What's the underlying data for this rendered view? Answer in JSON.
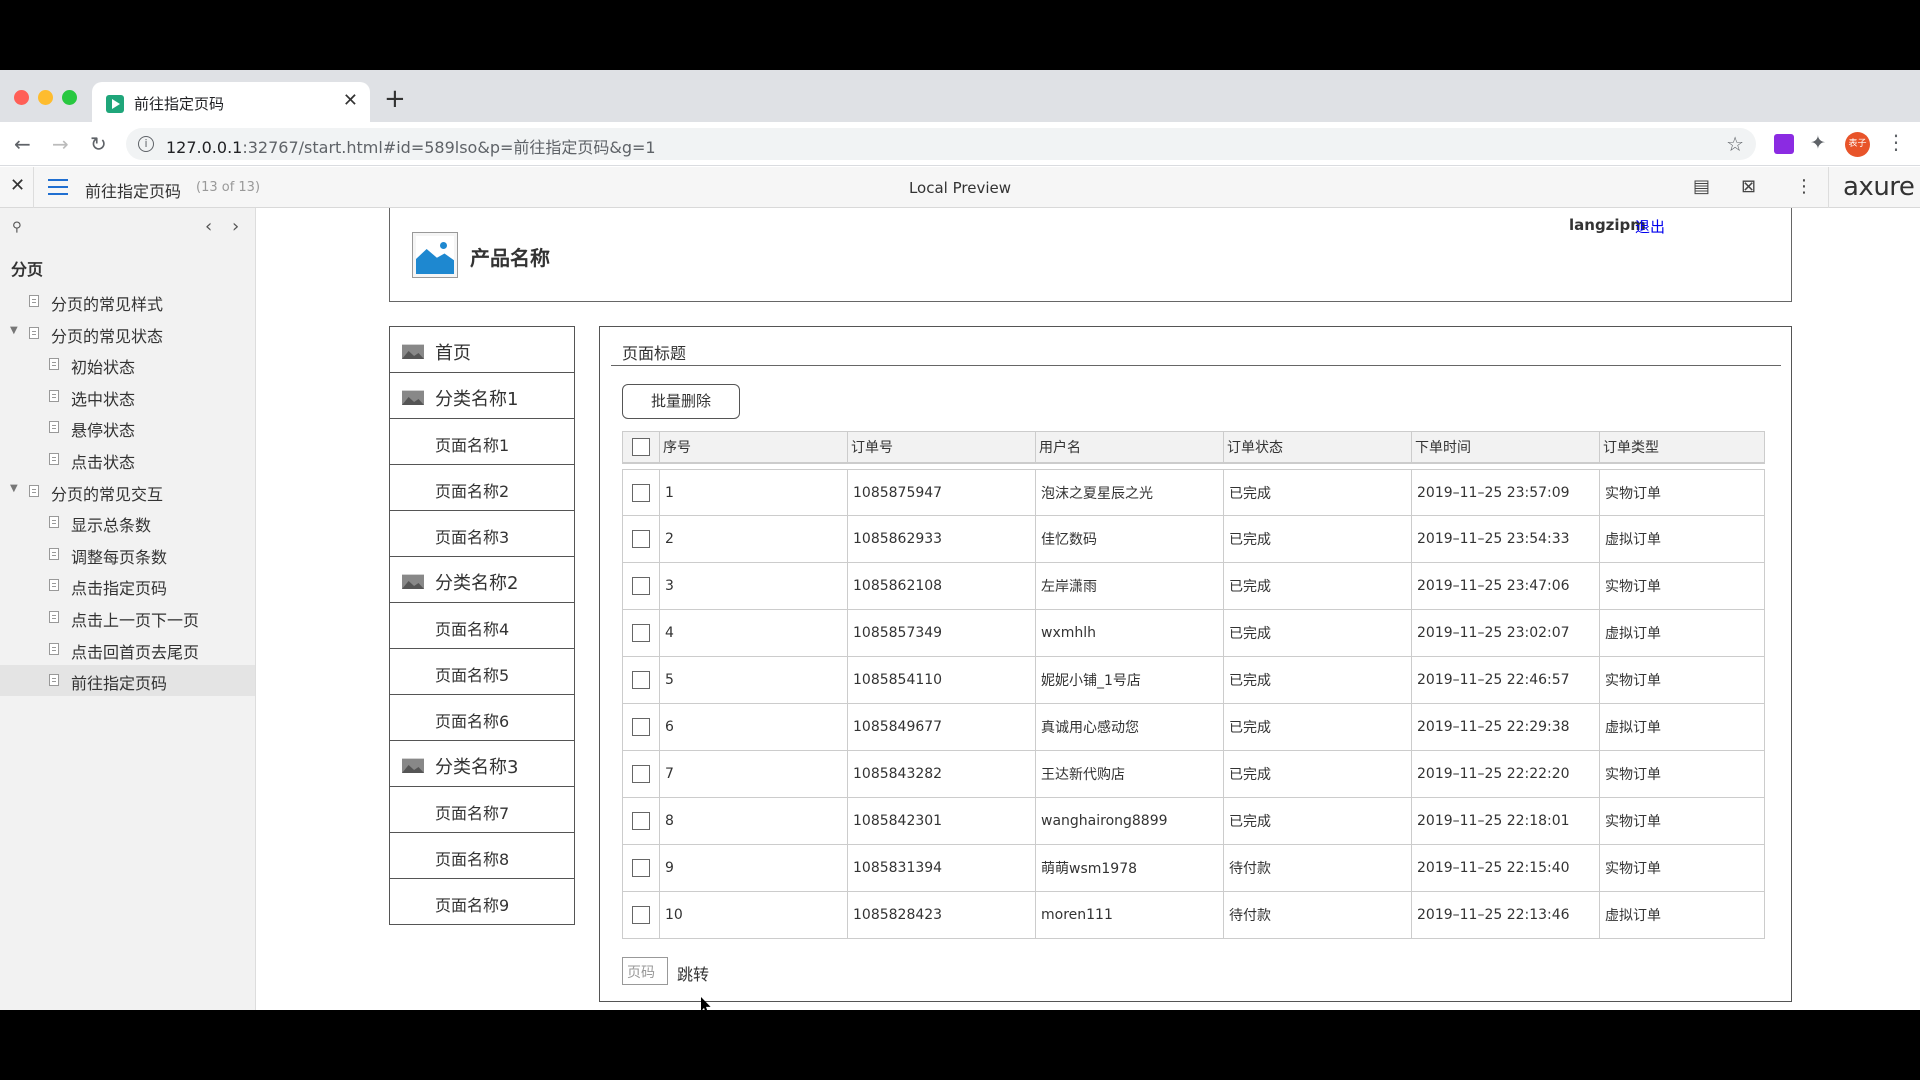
{
  "browser": {
    "tab_title": "前往指定页码",
    "tab_close": "✕",
    "new_tab": "+",
    "url_host": "127.0.0.1",
    "url_rest": ":32767/start.html#id=589lso&p=前往指定页码&g=1",
    "avatar_text": "表子"
  },
  "axure": {
    "close": "✕",
    "page_title": "前往指定页码",
    "page_count": "(13 of 13)",
    "center": "Local Preview",
    "logo": "axure"
  },
  "sitemap": {
    "heading": "分页",
    "items": [
      {
        "label": "分页的常见样式",
        "level": 1,
        "arrow": ""
      },
      {
        "label": "分页的常见状态",
        "level": 1,
        "arrow": "▼"
      },
      {
        "label": "初始状态",
        "level": 2,
        "arrow": ""
      },
      {
        "label": "选中状态",
        "level": 2,
        "arrow": ""
      },
      {
        "label": "悬停状态",
        "level": 2,
        "arrow": ""
      },
      {
        "label": "点击状态",
        "level": 2,
        "arrow": ""
      },
      {
        "label": "分页的常见交互",
        "level": 1,
        "arrow": "▼"
      },
      {
        "label": "显示总条数",
        "level": 2,
        "arrow": ""
      },
      {
        "label": "调整每页条数",
        "level": 2,
        "arrow": ""
      },
      {
        "label": "点击指定页码",
        "level": 2,
        "arrow": ""
      },
      {
        "label": "点击上一页下一页",
        "level": 2,
        "arrow": ""
      },
      {
        "label": "点击回首页去尾页",
        "level": 2,
        "arrow": ""
      },
      {
        "label": "前往指定页码",
        "level": 2,
        "arrow": "",
        "selected": true
      }
    ]
  },
  "header": {
    "product_name": "产品名称",
    "username": "langzipm",
    "logout": "退出"
  },
  "nav": [
    {
      "label": "首页",
      "type": "cat"
    },
    {
      "label": "分类名称1",
      "type": "cat"
    },
    {
      "label": "页面名称1",
      "type": "sub"
    },
    {
      "label": "页面名称2",
      "type": "sub"
    },
    {
      "label": "页面名称3",
      "type": "sub"
    },
    {
      "label": "分类名称2",
      "type": "cat"
    },
    {
      "label": "页面名称4",
      "type": "sub"
    },
    {
      "label": "页面名称5",
      "type": "sub"
    },
    {
      "label": "页面名称6",
      "type": "sub"
    },
    {
      "label": "分类名称3",
      "type": "cat"
    },
    {
      "label": "页面名称7",
      "type": "sub"
    },
    {
      "label": "页面名称8",
      "type": "sub"
    },
    {
      "label": "页面名称9",
      "type": "sub"
    }
  ],
  "content": {
    "page_title": "页面标题",
    "batch_delete": "批量删除",
    "columns": [
      "序号",
      "订单号",
      "用户名",
      "订单状态",
      "下单时间",
      "订单类型"
    ],
    "rows": [
      [
        "1",
        "1085875947",
        "泡沫之夏星辰之光",
        "已完成",
        "2019–11–25 23:57:09",
        "实物订单"
      ],
      [
        "2",
        "1085862933",
        "佳忆数码",
        "已完成",
        "2019–11–25 23:54:33",
        "虚拟订单"
      ],
      [
        "3",
        "1085862108",
        "左岸潇雨",
        "已完成",
        "2019–11–25 23:47:06",
        "实物订单"
      ],
      [
        "4",
        "1085857349",
        "wxmhlh",
        "已完成",
        "2019–11–25 23:02:07",
        "虚拟订单"
      ],
      [
        "5",
        "1085854110",
        "妮妮小铺_1号店",
        "已完成",
        "2019–11–25 22:46:57",
        "实物订单"
      ],
      [
        "6",
        "1085849677",
        "真诚用心感动您",
        "已完成",
        "2019–11–25 22:29:38",
        "虚拟订单"
      ],
      [
        "7",
        "1085843282",
        "王达新代购店",
        "已完成",
        "2019–11–25 22:22:20",
        "实物订单"
      ],
      [
        "8",
        "1085842301",
        "wanghairong8899",
        "已完成",
        "2019–11–25 22:18:01",
        "实物订单"
      ],
      [
        "9",
        "1085831394",
        "萌萌wsm1978",
        "待付款",
        "2019–11–25 22:15:40",
        "实物订单"
      ],
      [
        "10",
        "1085828423",
        "moren111",
        "待付款",
        "2019–11–25 22:13:46",
        "虚拟订单"
      ]
    ],
    "page_input_placeholder": "页码",
    "jump": "跳转"
  }
}
